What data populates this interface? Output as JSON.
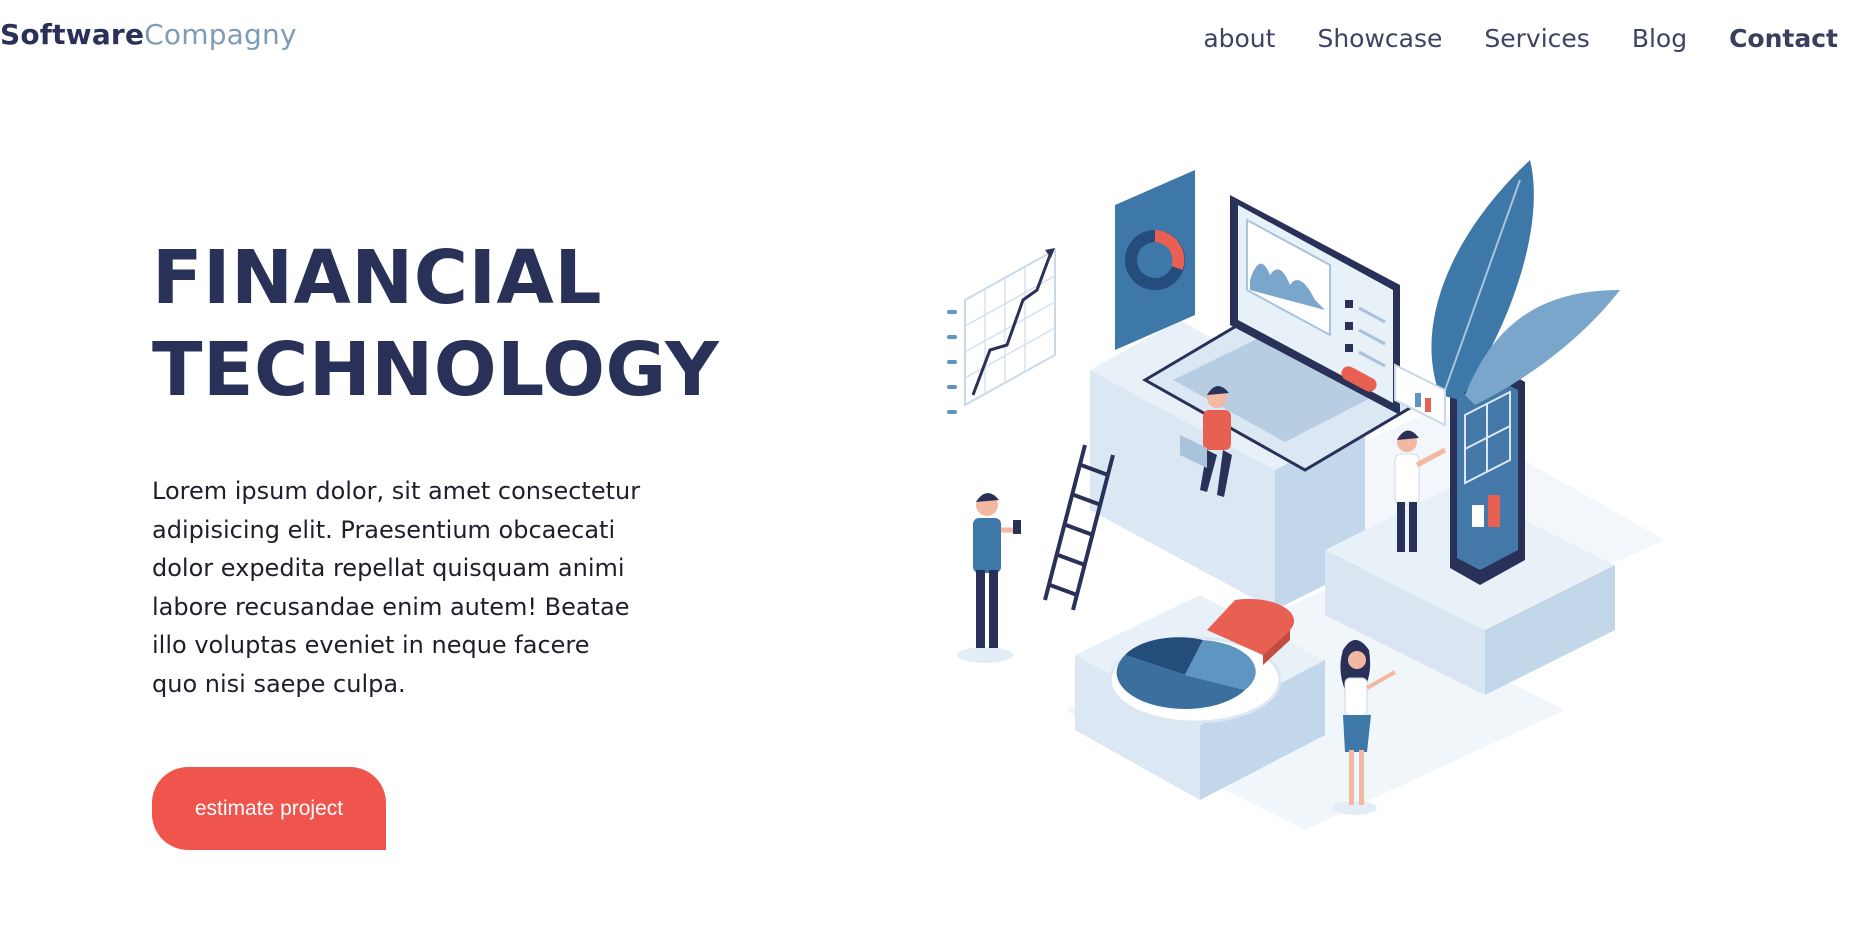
{
  "logo": {
    "bold": "Software",
    "light": "Compagny"
  },
  "nav": {
    "items": [
      "about",
      "Showcase",
      "Services",
      "Blog",
      "Contact"
    ]
  },
  "hero": {
    "title_line1": "FINANCIAL",
    "title_line2": "TECHNOLOGY",
    "description": "Lorem ipsum dolor, sit amet consectetur adipisicing elit. Praesentium obcaecati dolor expedita repellat quisquam animi labore recusandae enim autem! Beatae illo voluptas eveniet in neque facere quo nisi saepe culpa.",
    "cta_label": "estimate project"
  },
  "colors": {
    "brand_dark": "#2a3158",
    "brand_light": "#7f9bb6",
    "accent": "#ef544d",
    "illustration_blue": "#3d7fae",
    "illustration_pale": "#dbe8f4"
  }
}
